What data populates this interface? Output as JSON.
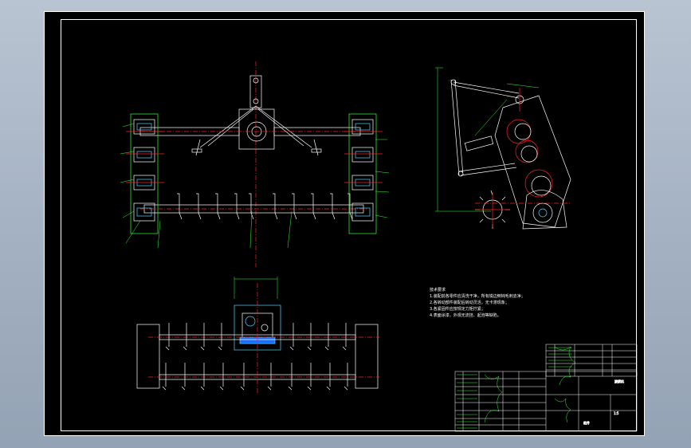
{
  "drawing": {
    "tech_requirements_title": "技术要求",
    "tech_requirements": [
      "1.装配前各零件应清洗干净，所有锐边倒钝毛刺去净；",
      "2.各转动部件装配后转动灵活，无卡滞现象；",
      "3.各紧固件应按规定力矩拧紧；",
      "4.表面涂漆，外观无流挂、起泡等缺陷。"
    ],
    "title_block": {
      "drawing_name": "旋耕机",
      "scale": "1:5",
      "material": "组件"
    }
  },
  "colors": {
    "background": "#000000",
    "frame": "#ffffff",
    "centerline": "#ff2020",
    "annotation": "#39ff39",
    "hatch": "#5ad0ff",
    "part": "#ffffff"
  }
}
